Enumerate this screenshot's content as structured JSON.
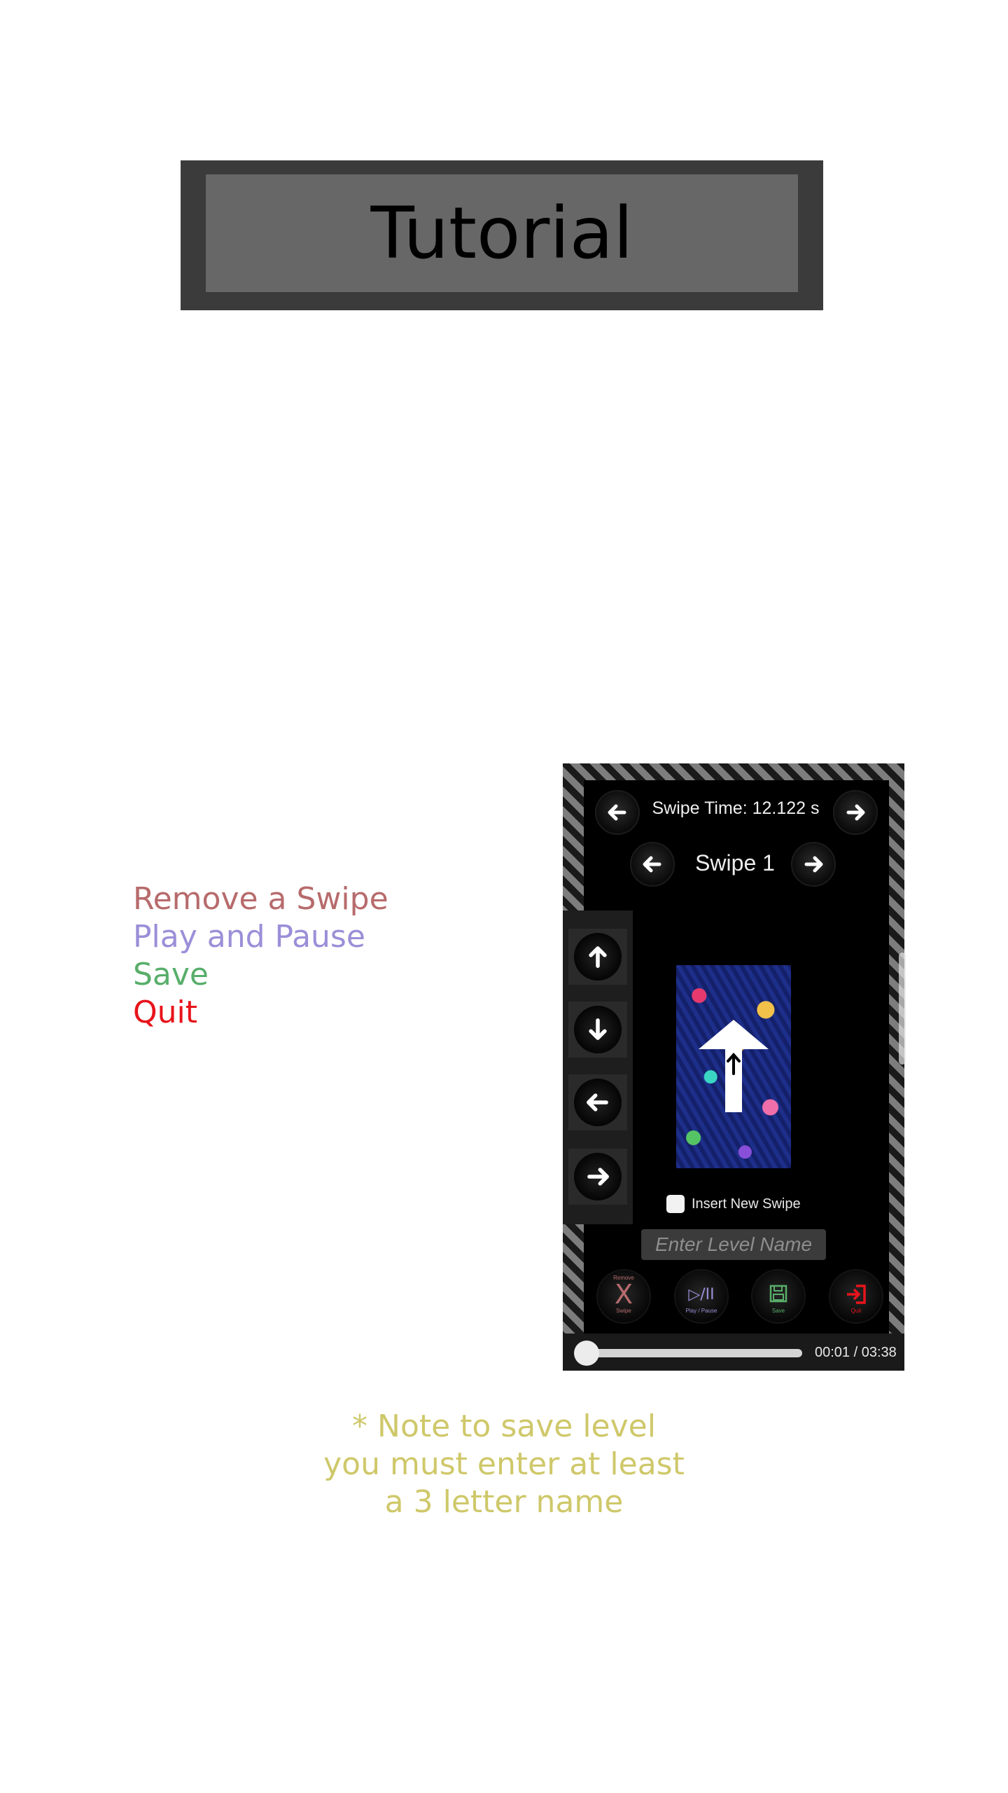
{
  "header": {
    "title": "Tutorial"
  },
  "legend": {
    "items": [
      {
        "label": "Remove a Swipe",
        "color": "#b76b6c"
      },
      {
        "label": "Play and Pause",
        "color": "#9a8fd8"
      },
      {
        "label": "Save",
        "color": "#58ae6a"
      },
      {
        "label": "Quit",
        "color": "#e8141b"
      }
    ]
  },
  "phone": {
    "swipe_time": "Swipe Time: 12.122 s",
    "swipe_label": "Swipe 1",
    "direction_buttons": [
      "up-arrow-icon",
      "down-arrow-icon",
      "left-arrow-icon",
      "right-arrow-icon"
    ],
    "insert_checkbox": {
      "label": "Insert New Swipe",
      "checked": false
    },
    "level_name": {
      "value": "",
      "placeholder": "Enter Level Name"
    },
    "actions": [
      {
        "glyph": "X",
        "top_caption": "Remove",
        "caption": "Swipe",
        "color": "#b76b6c"
      },
      {
        "glyph": "▷/II",
        "caption": "Play / Pause",
        "color": "#9a8fd8"
      },
      {
        "glyph": "💾",
        "caption": "Save",
        "color": "#58ae6a"
      },
      {
        "glyph": "⇥",
        "caption": "Quit",
        "color": "#e8141b"
      }
    ],
    "player": {
      "time": "00:01 / 03:38",
      "progress": 0.005
    }
  },
  "note": {
    "lines": [
      "* Note to save level",
      "you must enter at least",
      "a 3 letter name"
    ]
  }
}
